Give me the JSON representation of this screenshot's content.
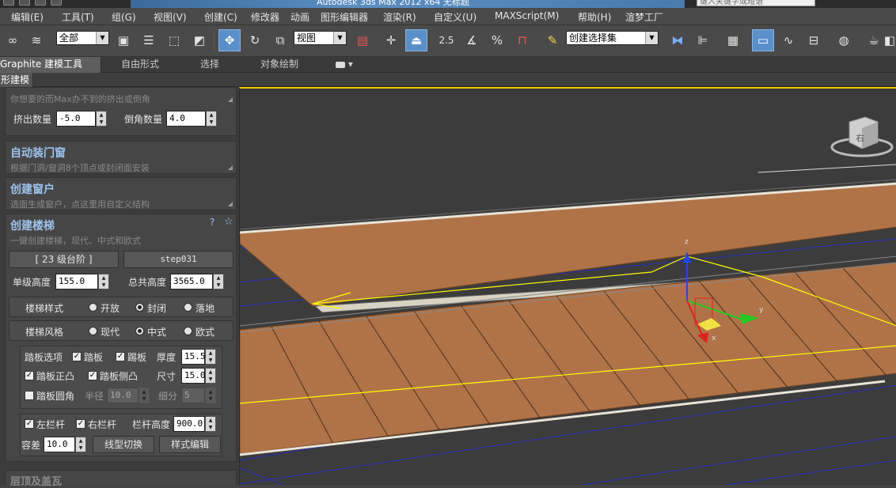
{
  "titlebar": {
    "title": "Autodesk 3ds Max  2012 x64    无标题",
    "search_placeholder": "键入关键字或短语"
  },
  "menubar": {
    "items": [
      "编辑(E)",
      "工具(T)",
      "组(G)",
      "视图(V)",
      "创建(C)",
      "修改器",
      "动画",
      "图形编辑器",
      "渲染(R)",
      "自定义(U)",
      "MAXScript(M)",
      "帮助(H)",
      "渲梦工厂"
    ]
  },
  "toolbar": {
    "selection_filter": "全部",
    "ref_coord": "视图",
    "snap_angle_label": "2.5",
    "named_selection": "创建选择集",
    "accent": "#5b8fc9"
  },
  "ribbon": {
    "tabs": [
      "Graphite 建模工具",
      "自由形式",
      "选择",
      "对象绘制"
    ],
    "subtab": "形建模"
  },
  "panel": {
    "extrude_section": {
      "subtitle": "你想要的而Max办不到的挤出或倒角",
      "extrude_label": "挤出数量",
      "extrude_value": "-5.0",
      "bevel_label": "倒角数量",
      "bevel_value": "4.0"
    },
    "auto_door": {
      "title": "自动装门窗",
      "subtitle": "根据门洞/窗洞8个顶点或封闭面安装"
    },
    "create_window": {
      "title": "创建窗户",
      "subtitle": "选面生成窗户，点这里用自定义结构"
    },
    "create_stairs": {
      "title": "创建楼梯",
      "subtitle": "一键创建楼梯，现代、中式和欧式",
      "help": "?",
      "star": "☆",
      "steps_button": "[ 23 级台阶 ]",
      "name_button": "step031",
      "step_height_label": "单级高度",
      "step_height_value": "155.0",
      "total_height_label": "总共高度",
      "total_height_value": "3565.0",
      "style_label": "楼梯样式",
      "style_options": [
        "开放",
        "封闭",
        "落地"
      ],
      "style_selected": 1,
      "flavor_label": "楼梯风格",
      "flavor_options": [
        "现代",
        "中式",
        "欧式"
      ],
      "flavor_selected": 1,
      "tread_options_label": "踏板选项",
      "tread_check": "踏板",
      "riser_check": "踢板",
      "thickness_label": "厚度",
      "thickness_value": "15.5",
      "front_bulge_check": "踏板正凸",
      "side_bulge_check": "踏板侧凸",
      "size_label": "尺寸",
      "size_value": "15.0",
      "round_check": "踏板圆角",
      "radius_label": "半径",
      "radius_value": "10.0",
      "segments_label": "细分",
      "segments_value": "5",
      "left_rail_check": "左栏杆",
      "right_rail_check": "右栏杆",
      "rail_height_label": "栏杆高度",
      "rail_height_value": "900.0",
      "tolerance_label": "容差",
      "tolerance_value": "10.0",
      "line_switch_button": "线型切换",
      "style_edit_button": "样式编辑"
    },
    "next_section_title": "层顶及盖瓦"
  },
  "viewport": {
    "gizmo": {
      "z": "z",
      "y": "y",
      "x": "x"
    },
    "viewcube_label": "右",
    "wood_color": "#b07348",
    "selection_color": "#ffff00"
  }
}
